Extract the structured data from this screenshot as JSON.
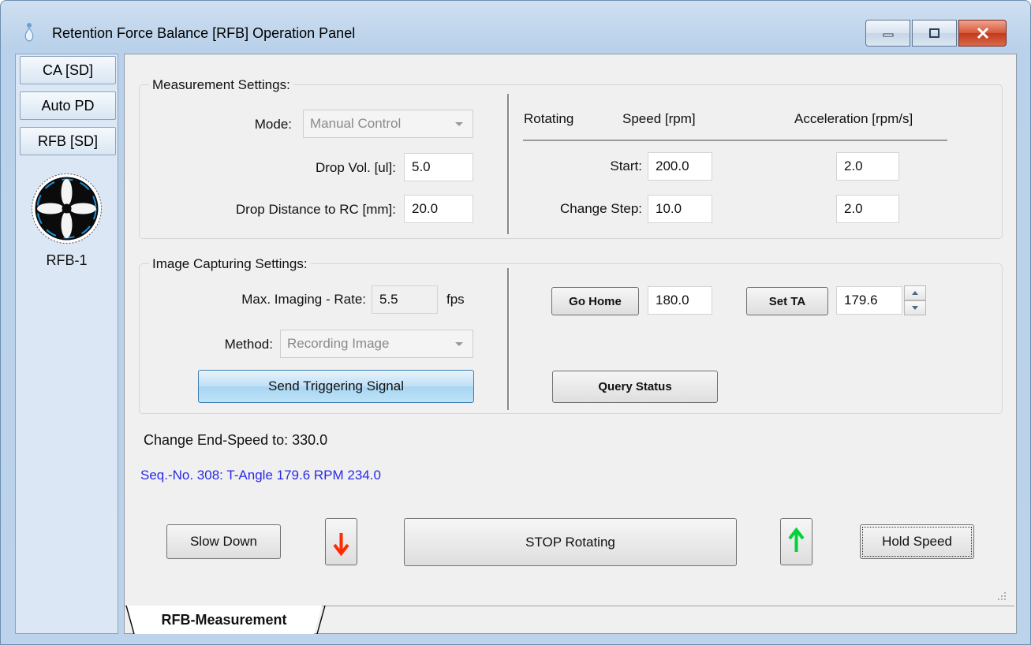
{
  "window": {
    "title": "Retention Force Balance [RFB] Operation Panel"
  },
  "sidebar": {
    "tabs": [
      {
        "label": "CA [SD]"
      },
      {
        "label": "Auto PD"
      },
      {
        "label": "RFB [SD]"
      }
    ],
    "device_label": "RFB-1"
  },
  "measurement": {
    "title": "Measurement Settings:",
    "mode_label": "Mode:",
    "mode_value": "Manual Control",
    "drop_vol_label": "Drop Vol. [ul]:",
    "drop_vol_value": "5.0",
    "drop_distance_label": "Drop Distance to RC [mm]:",
    "drop_distance_value": "20.0",
    "rotating_label": "Rotating",
    "speed_header": "Speed [rpm]",
    "accel_header": "Acceleration [rpm/s]",
    "start_label": "Start:",
    "start_speed": "200.0",
    "start_accel": "2.0",
    "change_step_label": "Change Step:",
    "change_step_speed": "10.0",
    "change_step_accel": "2.0"
  },
  "imaging": {
    "title": "Image Capturing Settings:",
    "rate_label": "Max. Imaging - Rate:",
    "rate_value": "5.5",
    "rate_unit": "fps",
    "method_label": "Method:",
    "method_value": "Recording Image",
    "send_trigger_label": "Send Triggering Signal",
    "go_home_label": "Go Home",
    "go_home_value": "180.0",
    "set_ta_label": "Set TA",
    "set_ta_value": "179.6",
    "query_status_label": "Query Status"
  },
  "status": {
    "end_speed_text": "Change End-Speed to: 330.0",
    "sequence_text": "Seq.-No. 308: T-Angle 179.6  RPM 234.0"
  },
  "controls": {
    "slow_down_label": "Slow Down",
    "down_arrow": "↓",
    "stop_label": "STOP Rotating",
    "up_arrow": "↑",
    "hold_speed_label": "Hold Speed"
  },
  "tabs": {
    "bottom_tab_label": "RFB-Measurement"
  },
  "colors": {
    "down_arrow": "#ff2a00",
    "up_arrow": "#00d23a",
    "sequence_text": "#2a2ae6"
  }
}
